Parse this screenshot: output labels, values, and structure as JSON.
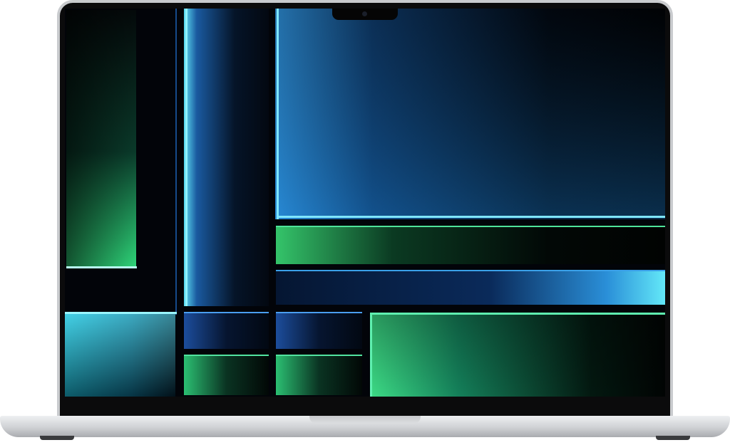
{
  "device": {
    "lid_color": "#c9cbce",
    "bezel_color": "#0b0b0c",
    "base_color": "#d4d6d9"
  },
  "wallpaper": {
    "palette": {
      "cyan": "#39d7f0",
      "blue": "#2a6ad6",
      "green": "#27d97a",
      "teal": "#1ac0b0",
      "dark": "#020409"
    }
  }
}
